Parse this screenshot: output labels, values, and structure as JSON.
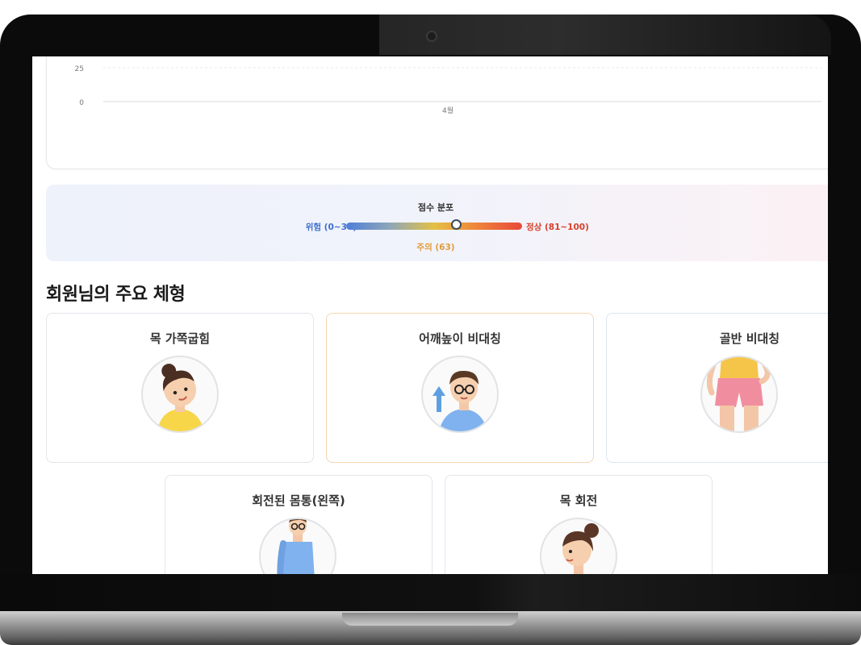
{
  "chart": {
    "y_ticks": [
      "25",
      "0"
    ],
    "x_label": "4월"
  },
  "chart_data": {
    "type": "line",
    "categories": [
      "4월"
    ],
    "series": [],
    "ylim": [
      0,
      25
    ],
    "ytick_labels": [
      "0",
      "25"
    ],
    "grid": true
  },
  "score": {
    "title": "점수 분포",
    "danger_label": "위험 (0~30)",
    "normal_label": "정상 (81~100)",
    "current_label": "주의 (63)",
    "current_value": 63,
    "min": 0,
    "max": 100,
    "colors": {
      "danger": "#3f6fcf",
      "normal": "#d9402b",
      "current": "#e39a3c"
    }
  },
  "section": {
    "title": "회원님의 주요 체형"
  },
  "types": [
    {
      "label": "목 가쪽굽힘",
      "icon": "head-tilt-woman-icon"
    },
    {
      "label": "어깨높이 비대칭",
      "icon": "shoulder-asymmetry-man-icon"
    },
    {
      "label": "골반 비대칭",
      "icon": "pelvis-asymmetry-icon"
    },
    {
      "label": "회전된 몸통(왼쪽)",
      "icon": "rotated-torso-icon"
    },
    {
      "label": "목 회전",
      "icon": "neck-rotation-woman-icon"
    }
  ]
}
